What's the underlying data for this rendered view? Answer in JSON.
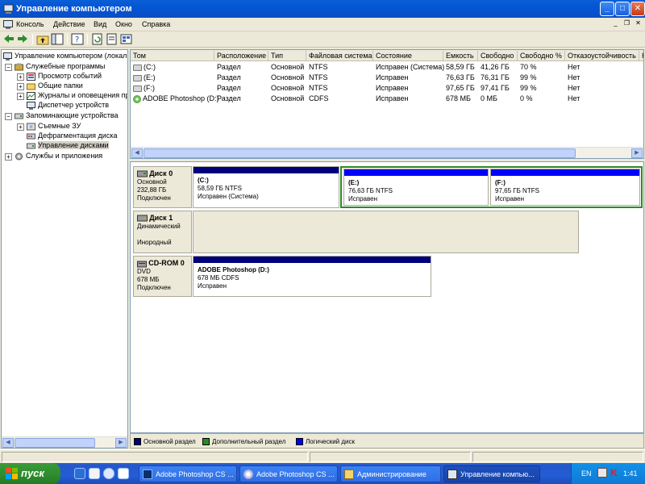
{
  "window": {
    "title": "Управление компьютером",
    "controls": {
      "minimize": "_",
      "maximize": "□",
      "close": "✕"
    }
  },
  "menu": {
    "items": [
      "Консоль",
      "Действие",
      "Вид",
      "Окно",
      "Справка"
    ],
    "mdi": {
      "minimize": "_",
      "restore": "❐",
      "close": "✕"
    }
  },
  "tree": {
    "root": "Управление компьютером (локаль",
    "groups": [
      {
        "label": "Служебные программы",
        "expander": "−",
        "items": [
          {
            "label": "Просмотр событий",
            "expander": "+"
          },
          {
            "label": "Общие папки",
            "expander": "+"
          },
          {
            "label": "Журналы и оповещения пр",
            "expander": "+"
          },
          {
            "label": "Диспетчер устройств",
            "expander": ""
          }
        ]
      },
      {
        "label": "Запоминающие устройства",
        "expander": "−",
        "items": [
          {
            "label": "Съемные ЗУ",
            "expander": "+"
          },
          {
            "label": "Дефрагментация диска",
            "expander": ""
          },
          {
            "label": "Управление дисками",
            "expander": ""
          }
        ]
      },
      {
        "label": "Службы и приложения",
        "expander": "+",
        "items": []
      }
    ]
  },
  "volumes_list": {
    "columns": [
      "Том",
      "Расположение",
      "Тип",
      "Файловая система",
      "Состояние",
      "Емкость",
      "Свободно",
      "Свободно %",
      "Отказоустойчивость",
      "Н"
    ],
    "rows": [
      {
        "name": "(C:)",
        "layout": "Раздел",
        "type": "Основной",
        "fs": "NTFS",
        "status": "Исправен (Система)",
        "capacity": "58,59 ГБ",
        "free": "41,26 ГБ",
        "free_pct": "70 %",
        "fault": "Нет",
        "icon": "disk-icon"
      },
      {
        "name": "(E:)",
        "layout": "Раздел",
        "type": "Основной",
        "fs": "NTFS",
        "status": "Исправен",
        "capacity": "76,63 ГБ",
        "free": "76,31 ГБ",
        "free_pct": "99 %",
        "fault": "Нет",
        "icon": "disk-icon"
      },
      {
        "name": "(F:)",
        "layout": "Раздел",
        "type": "Основной",
        "fs": "NTFS",
        "status": "Исправен",
        "capacity": "97,65 ГБ",
        "free": "97,41 ГБ",
        "free_pct": "99 %",
        "fault": "Нет",
        "icon": "disk-icon"
      },
      {
        "name": "ADOBE Photoshop (D:)",
        "layout": "Раздел",
        "type": "Основной",
        "fs": "CDFS",
        "status": "Исправен",
        "capacity": "678 МБ",
        "free": "0 МБ",
        "free_pct": "0 %",
        "fault": "Нет",
        "icon": "cd-icon"
      }
    ]
  },
  "disks": [
    {
      "name": "Диск 0",
      "type": "Основной",
      "size": "232,88 ГБ",
      "state": "Подключен",
      "volumes": [
        {
          "title": "(C:)",
          "detail": "58,59 ГБ NTFS",
          "status": "Исправен (Система)"
        },
        {
          "title": "(E:)",
          "detail": "76,63 ГБ NTFS",
          "status": "Исправен"
        },
        {
          "title": "(F:)",
          "detail": "97,65 ГБ NTFS",
          "status": "Исправен"
        }
      ]
    },
    {
      "name": "Диск 1",
      "type": "Динамический",
      "size": "",
      "state": "Инородный",
      "volumes": []
    },
    {
      "name": "CD-ROM 0",
      "type": "DVD",
      "size": "678 МБ",
      "state": "Подключен",
      "volumes": [
        {
          "title": "ADOBE Photoshop  (D:)",
          "detail": "678 МБ CDFS",
          "status": "Исправен"
        }
      ]
    }
  ],
  "legend": [
    {
      "label": "Основной раздел",
      "color": "#00007b"
    },
    {
      "label": "Дополнительный раздел",
      "color": "#2c8a25"
    },
    {
      "label": "Логический диск",
      "color": "#0000ff"
    }
  ],
  "colors": {
    "primary_partition": "#00007b",
    "extended_partition": "#2c8a25",
    "logical_drive": "#0000ff"
  },
  "taskbar": {
    "start_label": "пуск",
    "tasks": [
      {
        "label": "Adobe Photoshop CS ...",
        "icon": "photoshop-icon"
      },
      {
        "label": "Adobe Photoshop CS ...",
        "icon": "cd-icon"
      },
      {
        "label": "Администрирование",
        "icon": "folder-icon"
      },
      {
        "label": "Управление компью...",
        "icon": "computer-management-icon",
        "active": true
      }
    ],
    "tray": {
      "lang": "EN",
      "time": "1:41"
    }
  }
}
